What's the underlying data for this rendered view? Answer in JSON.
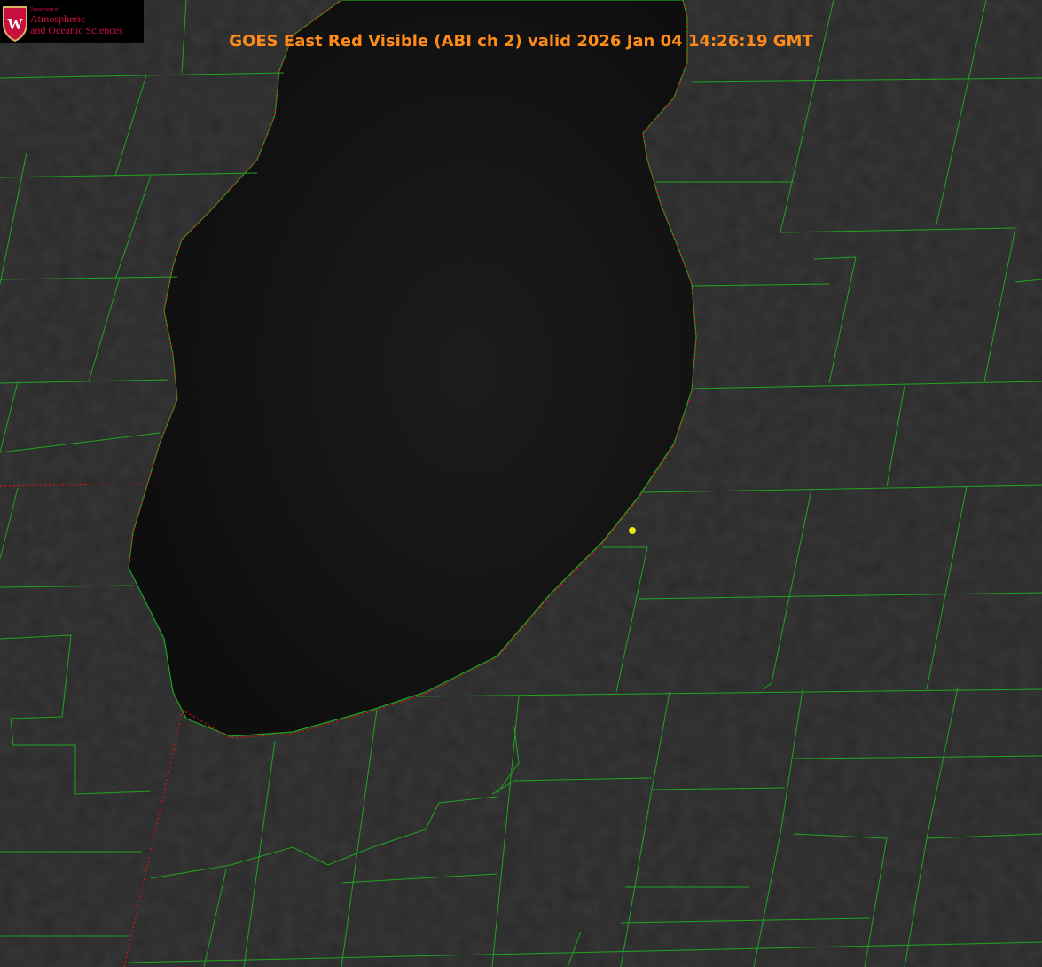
{
  "title": "GOES East Red Visible (ABI ch 2) valid 2026 Jan 04 14:26:19 GMT",
  "logo": {
    "line0": "Department of",
    "line1": "Atmospheric",
    "line2": "and Oceanic Sciences",
    "emblem": "W"
  },
  "colors": {
    "title": "#ff8c1a",
    "county_lines": "#1fa51f",
    "state_lines": "#e01010",
    "marker": "#e6e619",
    "logo": "#c8103e"
  }
}
